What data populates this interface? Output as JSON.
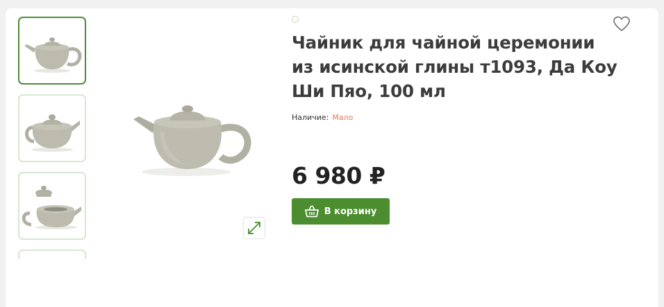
{
  "product": {
    "title": "Чайник для чайной церемонии из исинской глины т1093, Да Коу Ши Пяо, 100 мл",
    "availability_label": "Наличие:",
    "availability_value": "Мало",
    "price": "6 980 ₽",
    "cart_button_label": "В корзину"
  },
  "gallery": {
    "thumbnails": [
      {
        "view": "teapot-side-view"
      },
      {
        "view": "teapot-front-view"
      },
      {
        "view": "teapot-lid-off-view"
      },
      {
        "view": "teapot-partial-view"
      }
    ],
    "active_index": 0
  },
  "icons": {
    "favorite": "heart-icon",
    "zoom": "expand-arrows-icon",
    "cart": "basket-icon"
  },
  "colors": {
    "accent": "#4b8d2f",
    "availability_low": "#e8755a",
    "thumb_border": "#d5e8d0"
  }
}
